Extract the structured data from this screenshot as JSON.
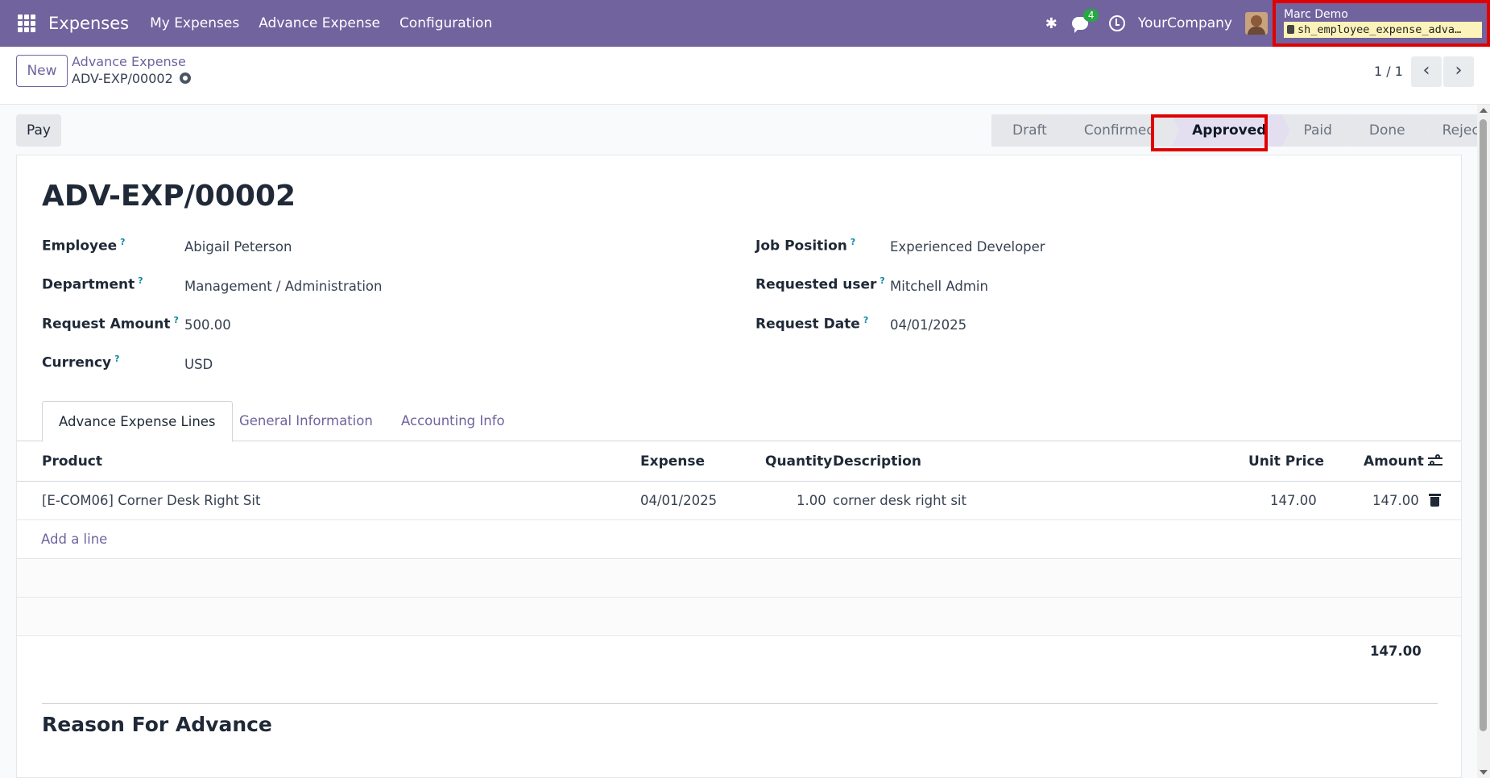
{
  "navbar": {
    "app_title": "Expenses",
    "menus": [
      "My Expenses",
      "Advance Expense",
      "Configuration"
    ],
    "chat_count": "4",
    "company": "YourCompany",
    "user_name": "Marc Demo",
    "database": "sh_employee_expense_adva…"
  },
  "control_panel": {
    "new_label": "New",
    "breadcrumb_parent": "Advance Expense",
    "breadcrumb_current": "ADV-EXP/00002",
    "pager": "1 / 1",
    "prev_glyph": "‹",
    "next_glyph": "›"
  },
  "actions": {
    "pay_label": "Pay"
  },
  "statusbar": {
    "stages": [
      "Draft",
      "Confirmed",
      "Approved",
      "Paid",
      "Done",
      "Reject"
    ],
    "active": "Approved"
  },
  "form": {
    "title": "ADV-EXP/00002",
    "left_fields": [
      {
        "label": "Employee",
        "value": "Abigail Peterson"
      },
      {
        "label": "Department",
        "value": "Management / Administration"
      },
      {
        "label": "Request Amount",
        "value": "500.00"
      },
      {
        "label": "Currency",
        "value": "USD"
      }
    ],
    "right_fields": [
      {
        "label": "Job Position",
        "value": "Experienced Developer"
      },
      {
        "label": "Requested user",
        "value": "Mitchell Admin"
      },
      {
        "label": "Request Date",
        "value": "04/01/2025"
      }
    ],
    "help_mark": "?"
  },
  "tabs": [
    "Advance Expense Lines",
    "General Information",
    "Accounting Info"
  ],
  "table": {
    "columns": [
      "Product",
      "Expense",
      "Quantity",
      "Description",
      "Unit Price",
      "Amount"
    ],
    "rows": [
      {
        "product": "[E-COM06] Corner Desk Right Sit",
        "expense": "04/01/2025",
        "quantity": "1.00",
        "description": "corner desk right sit",
        "unit_price": "147.00",
        "amount": "147.00"
      }
    ],
    "add_line": "Add a line",
    "total": "147.00"
  },
  "section": {
    "reason_title": "Reason For Advance"
  },
  "colors": {
    "navbar": "#71639e",
    "highlight": "#e00000",
    "db_background": "#fbf3b9"
  }
}
